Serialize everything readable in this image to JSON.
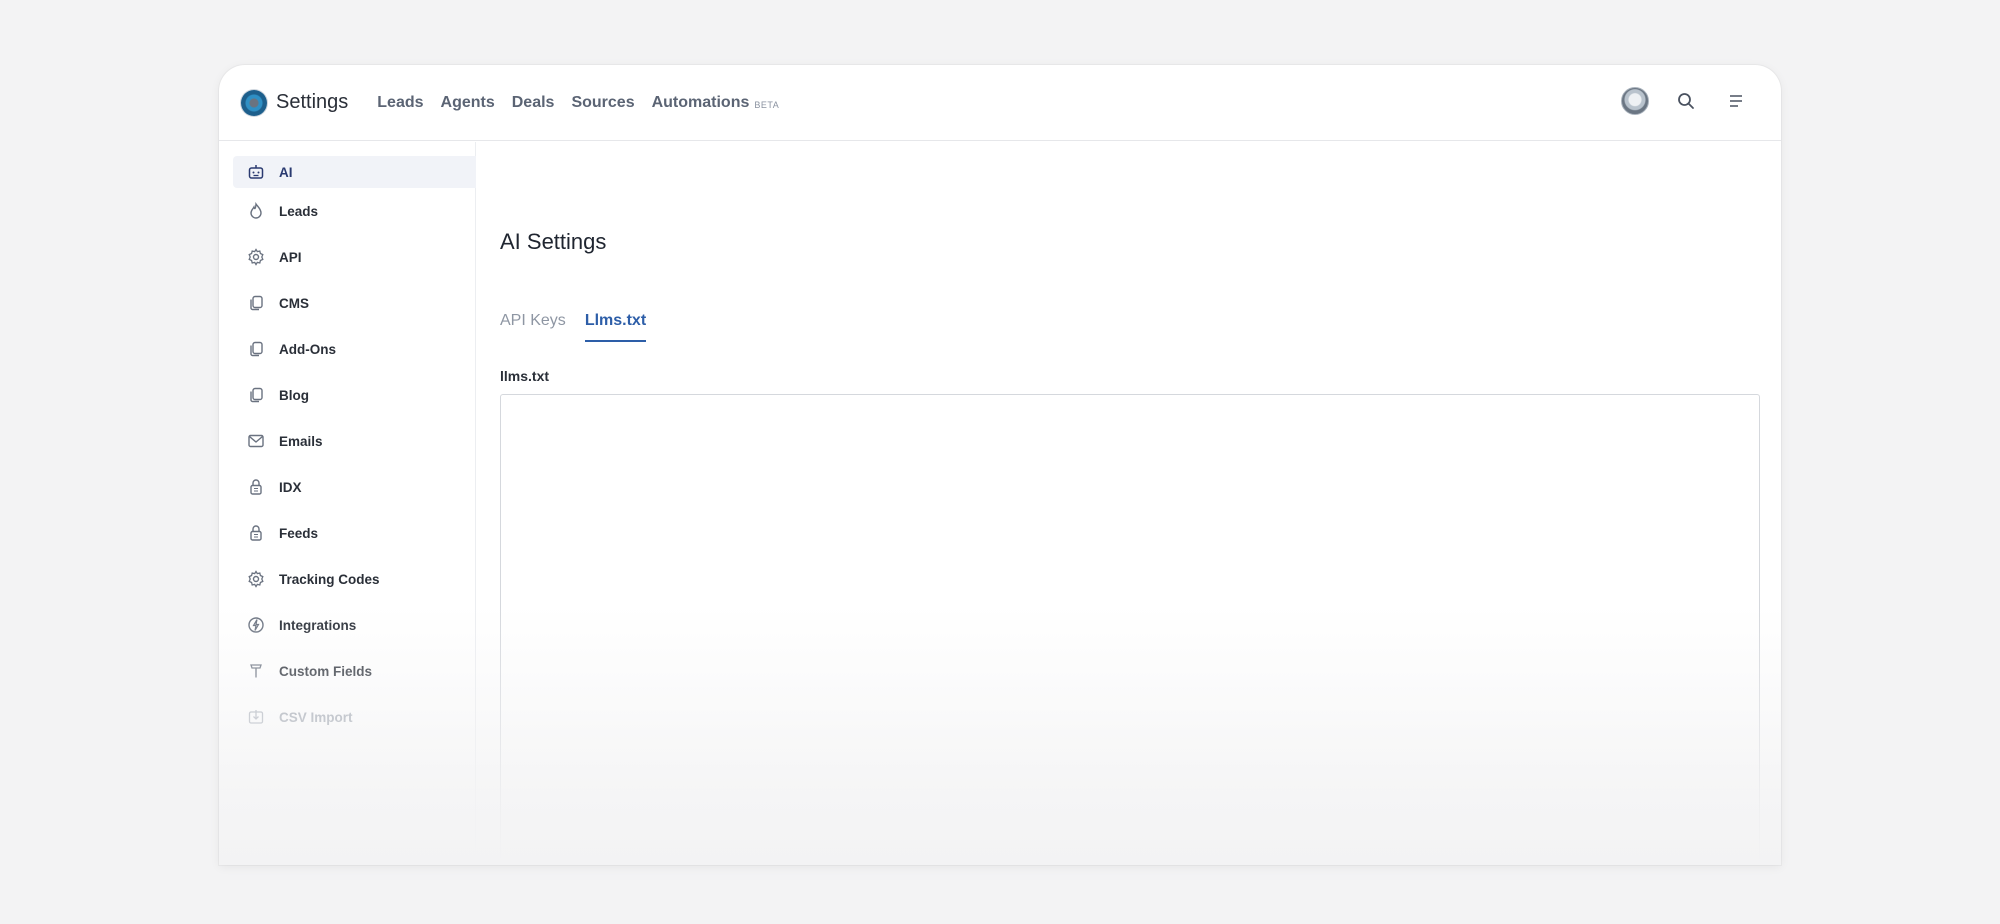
{
  "header": {
    "title": "Settings",
    "nav": [
      "Leads",
      "Agents",
      "Deals",
      "Sources",
      "Automations"
    ],
    "beta_badge": "BETA"
  },
  "sidebar": {
    "items": [
      {
        "label": "AI",
        "icon": "robot-icon",
        "active": true
      },
      {
        "label": "Leads",
        "icon": "flame-icon"
      },
      {
        "label": "API",
        "icon": "gear-icon"
      },
      {
        "label": "CMS",
        "icon": "copy-icon"
      },
      {
        "label": "Add-Ons",
        "icon": "copy-icon"
      },
      {
        "label": "Blog",
        "icon": "copy-icon"
      },
      {
        "label": "Emails",
        "icon": "mail-icon"
      },
      {
        "label": "IDX",
        "icon": "lock-icon"
      },
      {
        "label": "Feeds",
        "icon": "lock-icon"
      },
      {
        "label": "Tracking Codes",
        "icon": "gear-icon"
      },
      {
        "label": "Integrations",
        "icon": "bolt-icon"
      },
      {
        "label": "Custom Fields",
        "icon": "pin-icon"
      },
      {
        "label": "CSV Import",
        "icon": "import-icon"
      }
    ]
  },
  "main": {
    "title": "AI Settings",
    "tabs": [
      {
        "label": "API Keys",
        "active": false
      },
      {
        "label": "Llms.txt",
        "active": true
      }
    ],
    "field_label": "llms.txt",
    "field_value": ""
  },
  "colors": {
    "accent": "#2d5ea8",
    "active_bg": "#f1f3f8",
    "background": "#f3f3f4"
  }
}
